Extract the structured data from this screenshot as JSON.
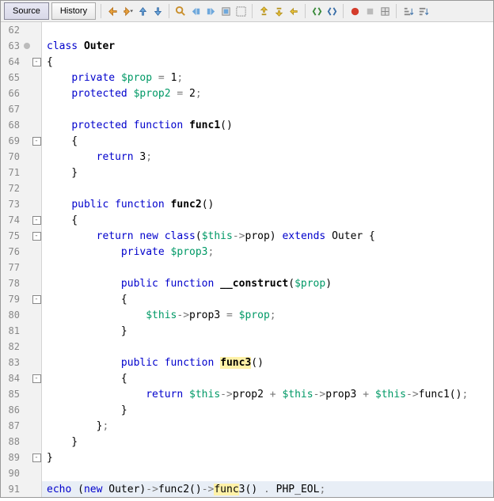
{
  "tabs": {
    "source": "Source",
    "history": "History"
  },
  "lineStart": 62,
  "lines": [
    {
      "n": 62,
      "html": ""
    },
    {
      "n": 63,
      "marker": "circ",
      "html": "<span class='kw'>class</span> <span class='func'>Outer</span>"
    },
    {
      "n": 64,
      "fold": true,
      "html": "{"
    },
    {
      "n": 65,
      "html": "    <span class='kw'>private</span> <span class='var'>$prop</span> <span class='op'>=</span> <span class='num'>1</span><span class='op'>;</span>"
    },
    {
      "n": 66,
      "html": "    <span class='kw'>protected</span> <span class='var'>$prop2</span> <span class='op'>=</span> <span class='num'>2</span><span class='op'>;</span>"
    },
    {
      "n": 67,
      "html": ""
    },
    {
      "n": 68,
      "html": "    <span class='kw'>protected function</span> <span class='func'>func1</span>()"
    },
    {
      "n": 69,
      "fold": true,
      "html": "    {"
    },
    {
      "n": 70,
      "html": "        <span class='kw'>return</span> <span class='num'>3</span><span class='op'>;</span>"
    },
    {
      "n": 71,
      "html": "    }"
    },
    {
      "n": 72,
      "html": ""
    },
    {
      "n": 73,
      "html": "    <span class='kw'>public function</span> <span class='func'>func2</span>()"
    },
    {
      "n": 74,
      "fold": true,
      "html": "    {"
    },
    {
      "n": 75,
      "fold": true,
      "html": "        <span class='kw'>return new</span> <span class='kw'>class</span>(<span class='var'>$this</span><span class='arrow'>-&gt;</span>prop) <span class='kw'>extends</span> Outer {"
    },
    {
      "n": 76,
      "html": "            <span class='kw'>private</span> <span class='var'>$prop3</span><span class='op'>;</span>"
    },
    {
      "n": 77,
      "html": ""
    },
    {
      "n": 78,
      "html": "            <span class='kw'>public function</span> <span class='func'>__construct</span>(<span class='var'>$prop</span>)"
    },
    {
      "n": 79,
      "fold": true,
      "html": "            {"
    },
    {
      "n": 80,
      "html": "                <span class='var'>$this</span><span class='arrow'>-&gt;</span>prop3 <span class='op'>=</span> <span class='var'>$prop</span><span class='op'>;</span>"
    },
    {
      "n": 81,
      "html": "            }"
    },
    {
      "n": 82,
      "html": ""
    },
    {
      "n": 83,
      "html": "            <span class='kw'>public function</span> <span class='func hl'>func3</span>()"
    },
    {
      "n": 84,
      "fold": true,
      "html": "            {"
    },
    {
      "n": 85,
      "html": "                <span class='kw'>return</span> <span class='var'>$this</span><span class='arrow'>-&gt;</span>prop2 <span class='op'>+</span> <span class='var'>$this</span><span class='arrow'>-&gt;</span>prop3 <span class='op'>+</span> <span class='var'>$this</span><span class='arrow'>-&gt;</span>func1()<span class='op'>;</span>"
    },
    {
      "n": 86,
      "html": "            }"
    },
    {
      "n": 87,
      "html": "        }<span class='op'>;</span>"
    },
    {
      "n": 88,
      "html": "    }"
    },
    {
      "n": 89,
      "fold": true,
      "html": "}"
    },
    {
      "n": 90,
      "html": ""
    },
    {
      "n": 91,
      "current": true,
      "html": "<span class='kw'>echo</span> (<span class='kw'>new</span> Outer)<span class='arrow'>-&gt;</span>func2()<span class='arrow'>-&gt;</span><span class='hl'>func</span>3() <span class='op'>.</span> PHP_EOL<span class='op'>;</span>"
    }
  ],
  "icons": [
    "back",
    "fwd-dd",
    "up",
    "down",
    "sep",
    "zoom",
    "prev-bm",
    "next-bm",
    "toggle-bm",
    "select",
    "sep",
    "shift-up",
    "shift-down",
    "shift-line",
    "sep",
    "comment",
    "uncomment",
    "sep",
    "record",
    "stop",
    "grid",
    "sep",
    "sort1",
    "sort2"
  ]
}
